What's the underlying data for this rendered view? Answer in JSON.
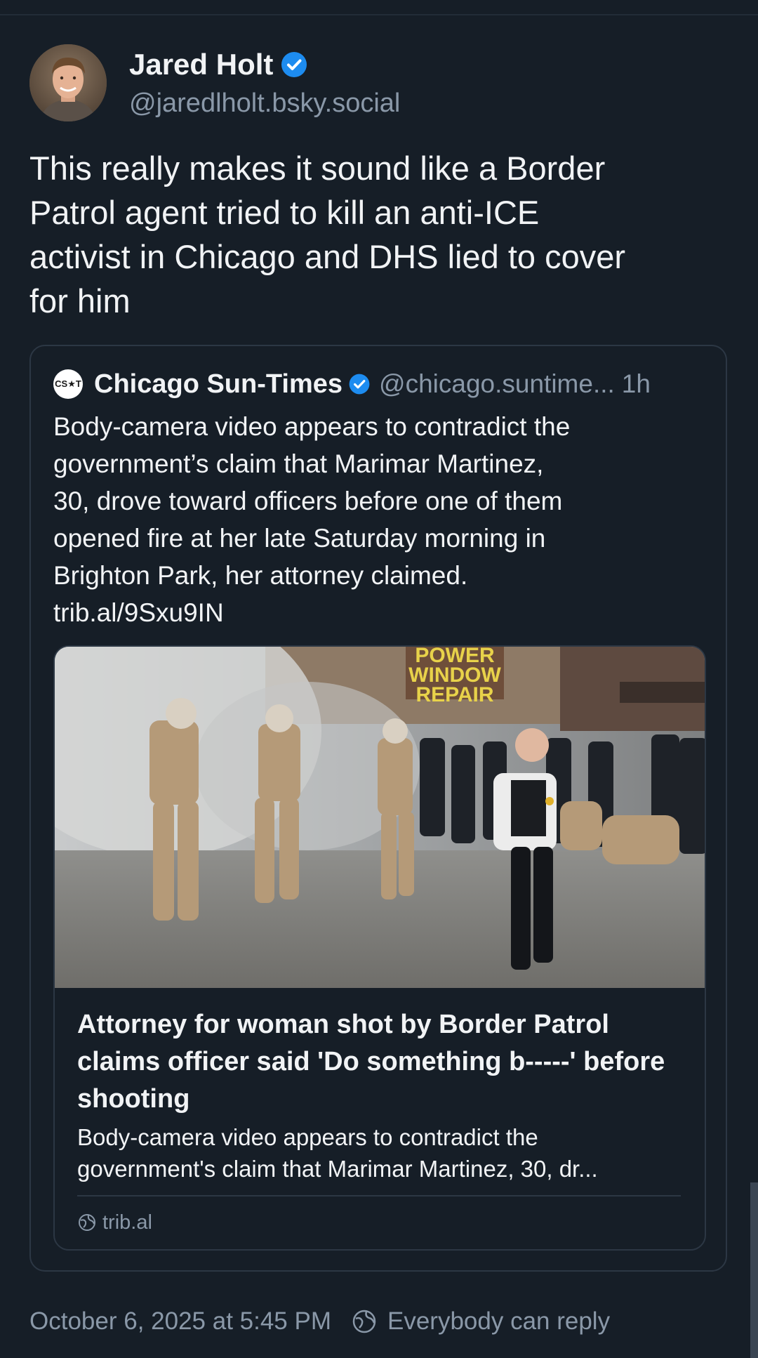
{
  "author": {
    "display_name": "Jared Holt",
    "handle": "@jaredlholt.bsky.social",
    "verified_icon": "verified-check-icon",
    "accent_color": "#1d8cf0"
  },
  "post": {
    "text": "This really makes it sound like a Border\nPatrol agent tried to kill an anti-ICE\nactivist in Chicago and DHS lied to cover\nfor him"
  },
  "quoted_post": {
    "avatar_text": "CS★T",
    "display_name": "Chicago Sun-Times",
    "handle": "@chicago.suntime...",
    "time": "1h",
    "text": "Body-camera video appears to contradict the\ngovernment’s claim that Marimar Martinez,\n30, drove toward officers before one of them\nopened fire at her late Saturday morning in\nBrighton Park, her attorney claimed.\ntrib.al/9Sxu9IN",
    "link_card": {
      "image_signs": [
        "POWER",
        "WINDOW",
        "REPAIR"
      ],
      "title": "Attorney for woman shot by Border Patrol claims officer said 'Do something b-----' before shooting",
      "description": "Body-camera video appears to contradict the\ngovernment's claim that Marimar Martinez, 30, dr...",
      "domain": "trib.al",
      "domain_icon": "globe-icon"
    }
  },
  "footer": {
    "timestamp": "October 6, 2025 at 5:45 PM",
    "reply_setting": "Everybody can reply",
    "reply_icon": "globe-icon"
  },
  "colors": {
    "background": "#161e27",
    "border": "#2c3744",
    "muted_text": "#8a98a8",
    "primary_text": "#f1f3f5"
  }
}
